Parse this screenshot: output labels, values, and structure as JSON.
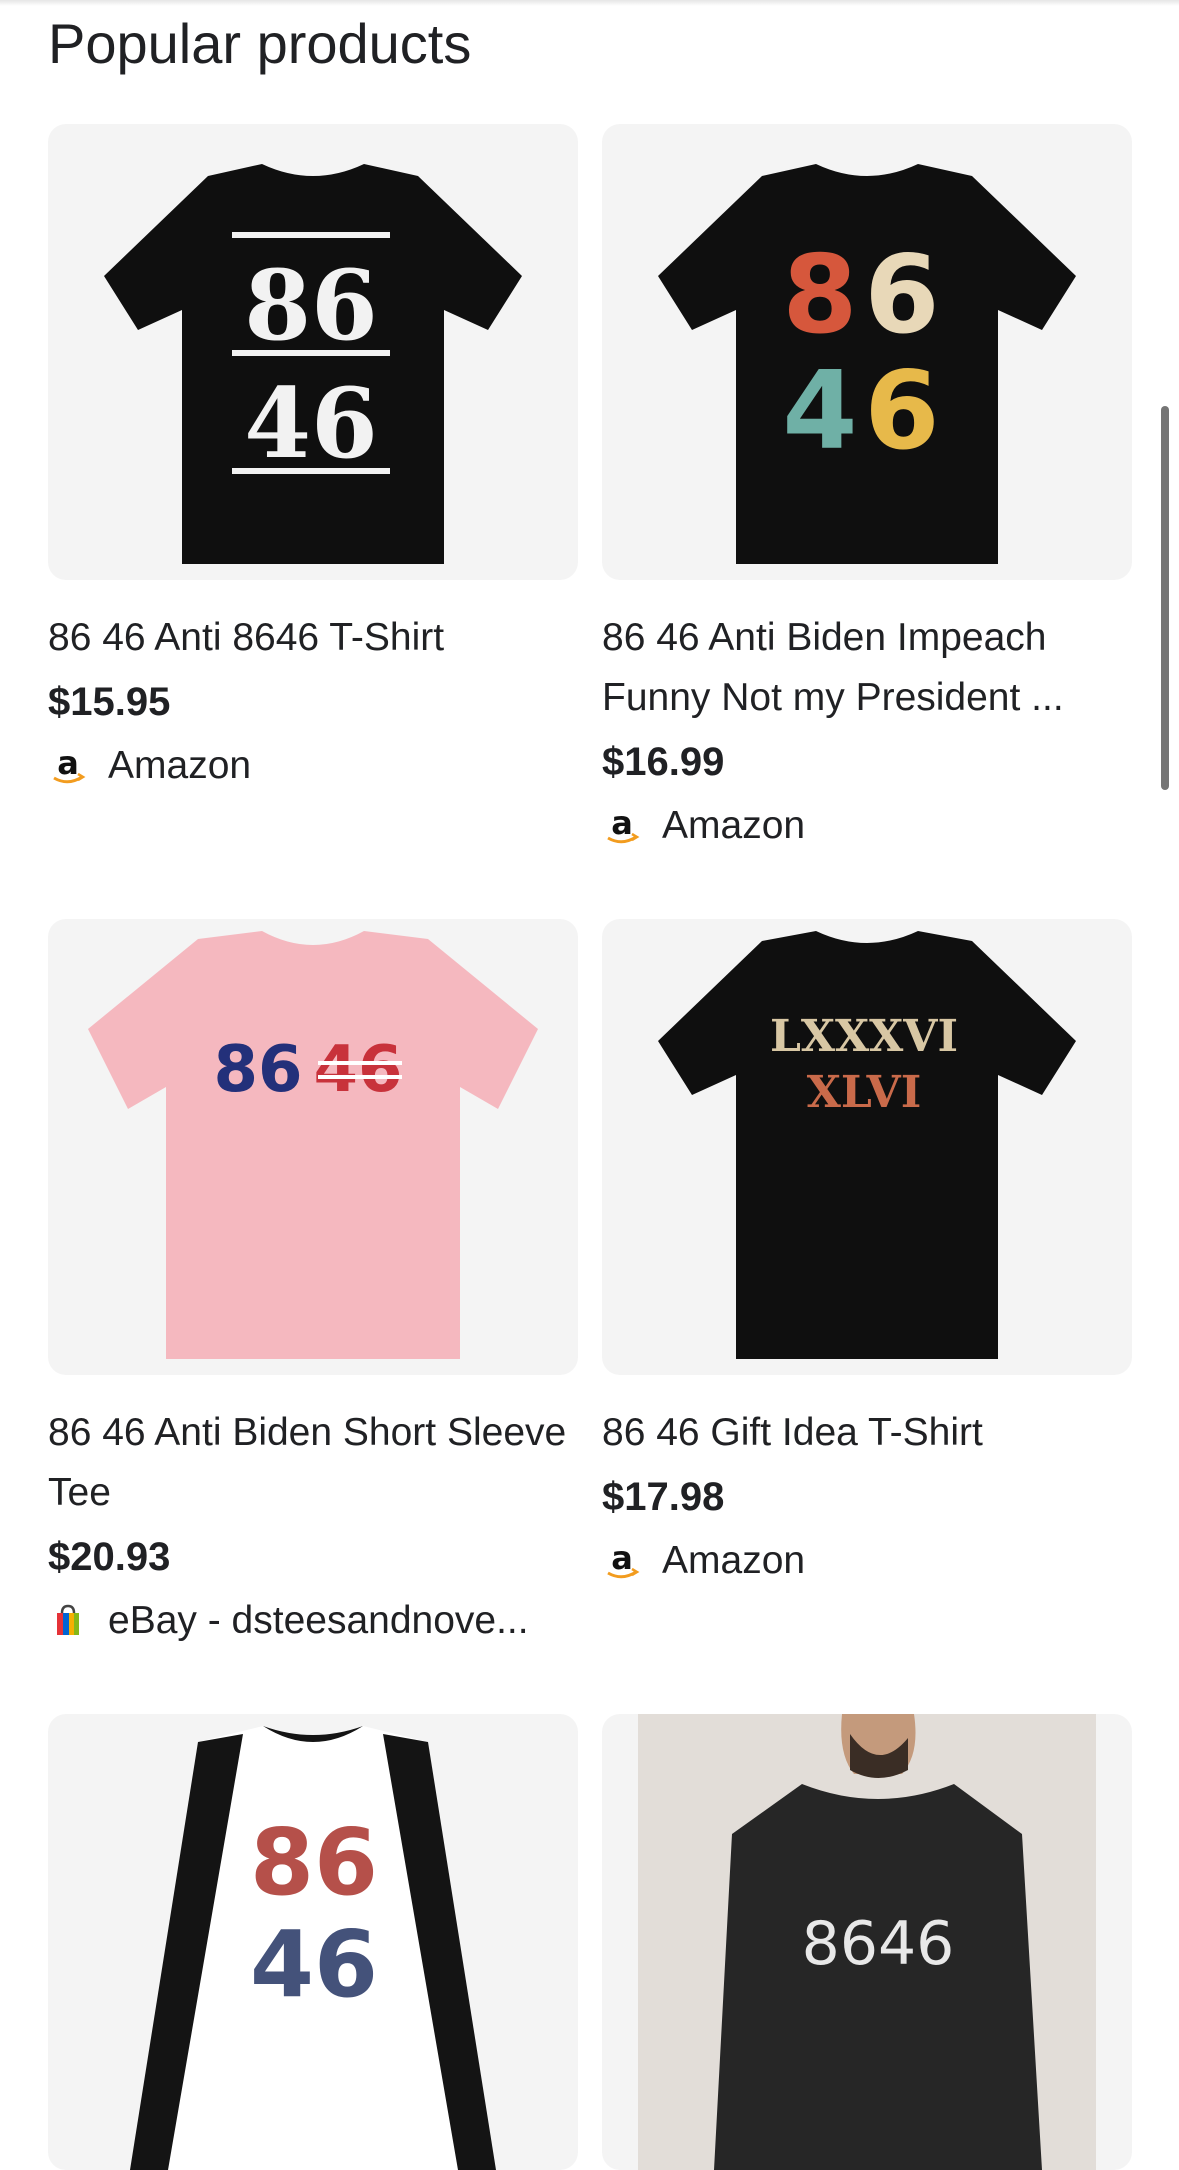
{
  "section": {
    "title": "Popular products"
  },
  "products": [
    {
      "title": "86 46 Anti 8646 T-Shirt",
      "price": "$15.95",
      "seller": "Amazon",
      "seller_icon": "amazon-icon",
      "shirt": {
        "color": "#0f0f0f",
        "print_lines": [
          "86",
          "46"
        ]
      }
    },
    {
      "title": "86 46 Anti Biden Impeach Funny Not my President ...",
      "price": "$16.99",
      "seller": "Amazon",
      "seller_icon": "amazon-icon",
      "shirt": {
        "color": "#0f0f0f",
        "print_lines": [
          "86",
          "46"
        ],
        "digit_colors": [
          "#d6573c",
          "#e8d8b8",
          "#6fb0a6",
          "#e7b94a"
        ]
      }
    },
    {
      "title": "86 46 Anti Biden Short Sleeve Tee",
      "price": "$20.93",
      "seller": "eBay - dsteesandnove...",
      "seller_icon": "ebay-bag-icon",
      "shirt": {
        "color": "#f5b8bf",
        "print_lines": [
          "8646"
        ]
      }
    },
    {
      "title": "86 46 Gift Idea T-Shirt",
      "price": "$17.98",
      "seller": "Amazon",
      "seller_icon": "amazon-icon",
      "shirt": {
        "color": "#0f0f0f",
        "print_lines": [
          "LXXXVI",
          "XLVI"
        ]
      }
    },
    {
      "title": "",
      "price": "",
      "seller": "",
      "seller_icon": "",
      "shirt": {
        "color": "#ffffff",
        "sleeve_color": "#141414",
        "print_lines": [
          "86",
          "46"
        ]
      }
    },
    {
      "title": "",
      "price": "",
      "seller": "",
      "seller_icon": "",
      "shirt": {
        "color": "#262626",
        "print_lines": [
          "8646"
        ]
      }
    }
  ]
}
